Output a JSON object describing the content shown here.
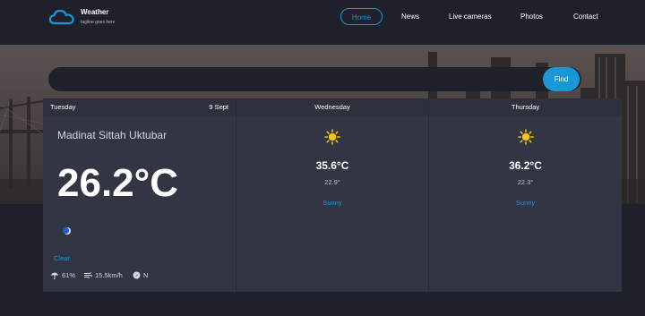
{
  "header": {
    "brand_title": "Weather",
    "brand_tagline": "tagline goes here",
    "nav": [
      {
        "label": "Home",
        "active": true
      },
      {
        "label": "News",
        "active": false
      },
      {
        "label": "Live cameras",
        "active": false
      },
      {
        "label": "Photos",
        "active": false
      },
      {
        "label": "Contact",
        "active": false
      }
    ]
  },
  "search": {
    "placeholder": "",
    "value": "",
    "button_label": "Find"
  },
  "forecast": {
    "today": {
      "day": "Tuesday",
      "date": "9 Sept",
      "location": "Madinat Sittah Uktubar",
      "temperature": "26.2°C",
      "icon": "moon-icon",
      "condition": "Clear",
      "humidity": "61%",
      "wind_speed": "15.5km/h",
      "wind_direction": "N"
    },
    "days": [
      {
        "day": "Wednesday",
        "icon": "sun-icon",
        "max": "35.6°C",
        "min": "22.9°",
        "condition": "Sunny"
      },
      {
        "day": "Thursday",
        "icon": "sun-icon",
        "max": "36.2°C",
        "min": "22.3°",
        "condition": "Sunny"
      }
    ]
  },
  "colors": {
    "accent": "#1a97d5",
    "background": "#1e202b",
    "panel": "#323544",
    "panel_header": "#2d303d",
    "sun": "#f5c518"
  }
}
